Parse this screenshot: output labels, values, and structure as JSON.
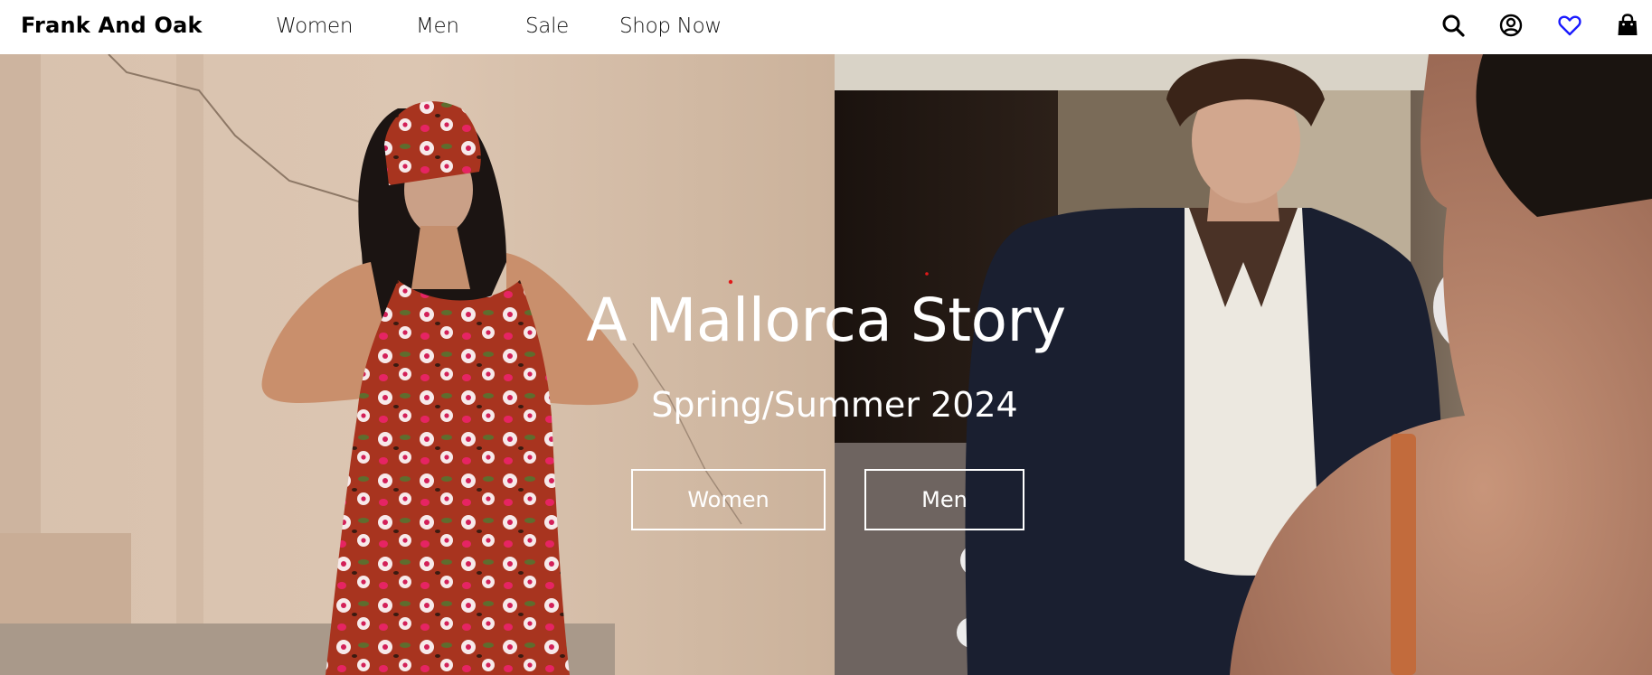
{
  "header": {
    "brand": "Frank And Oak",
    "nav": [
      {
        "label": "Women"
      },
      {
        "label": "Men"
      },
      {
        "label": "Sale"
      },
      {
        "label": "Shop Now"
      }
    ],
    "icons": {
      "search": "search-icon",
      "account": "account-icon",
      "wishlist": "heart-icon",
      "bag": "shopping-bag-icon"
    }
  },
  "hero": {
    "title": "A Mallorca Story",
    "subtitle": "Spring/Summer 2024",
    "buttons": {
      "women": "Women",
      "men": "Men"
    }
  },
  "colors": {
    "wishlist_accent": "#1a1aff",
    "text_on_image": "#ffffff"
  }
}
